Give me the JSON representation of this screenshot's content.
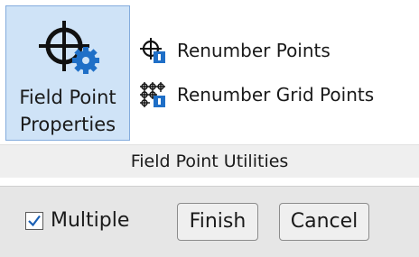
{
  "ribbon": {
    "panel_title": "Field Point Utilities",
    "big_button": {
      "label_line1": "Field Point",
      "label_line2": "Properties",
      "icon": "crosshair-gear-icon"
    },
    "small_buttons": [
      {
        "label": "Renumber Points",
        "icon": "crosshair-number-icon"
      },
      {
        "label": "Renumber Grid Points",
        "icon": "grid-number-icon"
      }
    ]
  },
  "options_bar": {
    "checkbox_label": "Multiple",
    "checkbox_checked": true,
    "finish_label": "Finish",
    "cancel_label": "Cancel"
  },
  "colors": {
    "selected_bg": "#cfe3f7",
    "selected_border": "#84acdd",
    "gear_blue": "#1f6fc7",
    "options_bg": "#e6e6e6"
  }
}
